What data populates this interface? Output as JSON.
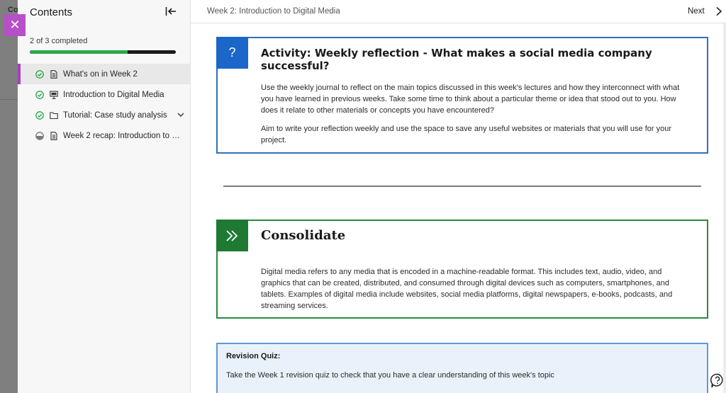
{
  "background_overlay": {
    "ghost_text": "Co"
  },
  "close_button": {
    "glyph": "✕"
  },
  "sidebar": {
    "title": "Contents",
    "progress_text": "2 of 3 completed",
    "progress_fraction": 0.67,
    "items": [
      {
        "label": "What's on in Week 2",
        "status": "completed",
        "type": "document-icon",
        "active": true
      },
      {
        "label": "Introduction to Digital Media",
        "status": "completed",
        "type": "presentation-icon",
        "active": false
      },
      {
        "label": "Tutorial: Case study analysis",
        "status": "completed",
        "type": "folder-icon",
        "active": false,
        "expandable": true
      },
      {
        "label": "Week 2 recap: Introduction to di...",
        "status": "in-progress",
        "type": "document-icon",
        "active": false
      }
    ]
  },
  "topbar": {
    "breadcrumb": "Week 2: Introduction to Digital Media",
    "next_label": "Next"
  },
  "activity_card": {
    "badge": "?",
    "title": "Activity: Weekly reflection - What makes a social media company successful?",
    "paragraphs": [
      "Use the weekly journal to reflect on the main topics discussed in this week's lectures and how they interconnect with what you have learned in previous weeks. Take some time to think about a particular theme or idea that stood out to you. How does it relate to other materials or concepts you have encountered?",
      "Aim to write your reflection weekly and use the space to save any useful websites or materials that you will use for your project."
    ]
  },
  "consolidate_card": {
    "title": "Consolidate",
    "body": "Digital media refers to any media that is encoded in a machine-readable format. This includes text, audio, video, and graphics that can be created, distributed, and consumed through digital devices such as computers, smartphones, and tablets. Examples of digital media include websites, social media platforms, digital newspapers, e-books, podcasts, and streaming services."
  },
  "revision_quiz": {
    "title": "Revision Quiz:",
    "body": "Take the Week 1 revision quiz to check that you have a clear understanding of this week's topic"
  },
  "colors": {
    "accent_purple": "#a63fbf",
    "progress_green": "#2ba84a",
    "activity_blue": "#1a66c9",
    "consolidate_green": "#1e7a33"
  }
}
